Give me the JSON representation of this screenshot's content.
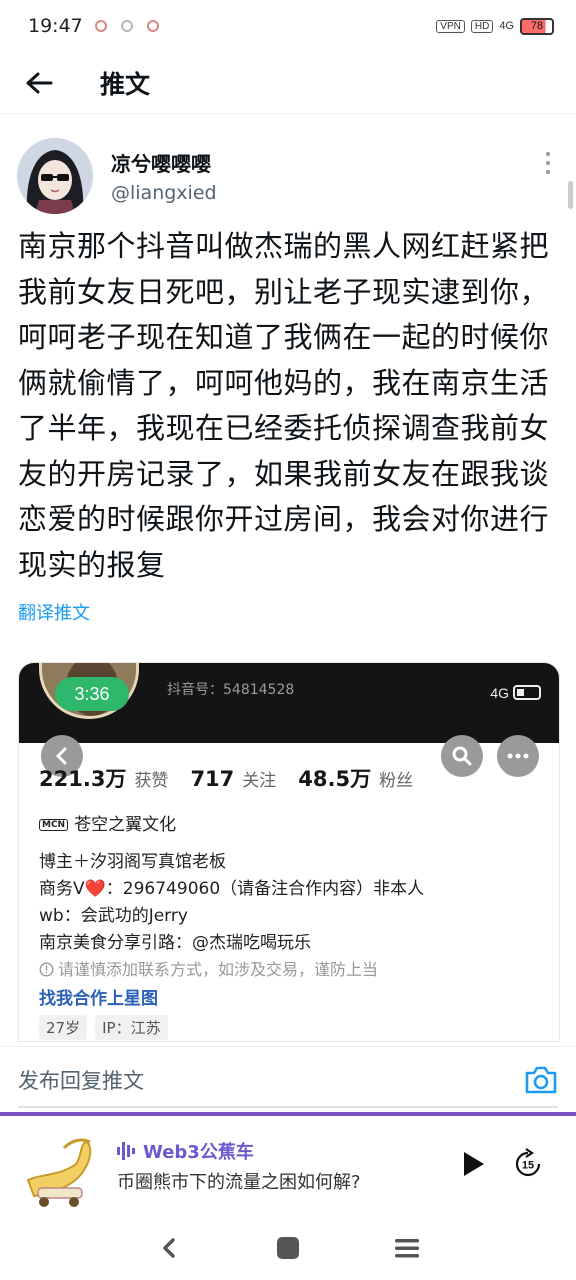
{
  "status_bar": {
    "time": "19:47",
    "vpn": "VPN",
    "hd": "HD",
    "signal": "4G",
    "battery": "78"
  },
  "header": {
    "title": "推文"
  },
  "tweet": {
    "author_name": "凉兮嘤嘤嘤",
    "author_handle": "@liangxied",
    "text": "南京那个抖音叫做杰瑞的黑人网红赶紧把我前女友日死吧，别让老子现实逮到你，呵呵老子现在知道了我俩在一起的时候你俩就偷情了，呵呵他妈的，我在南京生活了半年，我现在已经委托侦探调查我前女友的开房记录了，如果我前女友在跟我谈恋爱的时候跟你开过房间，我会对你进行现实的报复",
    "translate_label": "翻译推文"
  },
  "media": {
    "live_badge": "3:36",
    "account_id": "抖音号：54814528",
    "signal": "4G",
    "stats": [
      {
        "value": "221.3万",
        "label": "获赞"
      },
      {
        "value": "717",
        "label": "关注"
      },
      {
        "value": "48.5万",
        "label": "粉丝"
      }
    ],
    "mcn_badge": "MCN",
    "mcn_name": "苍空之翼文化",
    "bio_lines": [
      "博主＋汐羽阁写真馆老板",
      "商务V❤️：296749060（请备注合作内容）非本人",
      "wb：会武功的Jerry",
      "南京美食分享引路：@杰瑞吃喝玩乐"
    ],
    "warning": "请谨慎添加联系方式，如涉及交易，谨防上当",
    "star_link": "找我合作上星图",
    "age_chip": "27岁",
    "ip_chip": "IP：江苏"
  },
  "reply": {
    "placeholder": "发布回复推文"
  },
  "player": {
    "channel": "Web3公蕉车",
    "episode_title": "币圈熊市下的流量之困如何解?",
    "skip_seconds": "15"
  },
  "colors": {
    "accent_link": "#1d9bf0",
    "player_accent": "#7b4fc4",
    "live_green": "#2fb86b"
  }
}
